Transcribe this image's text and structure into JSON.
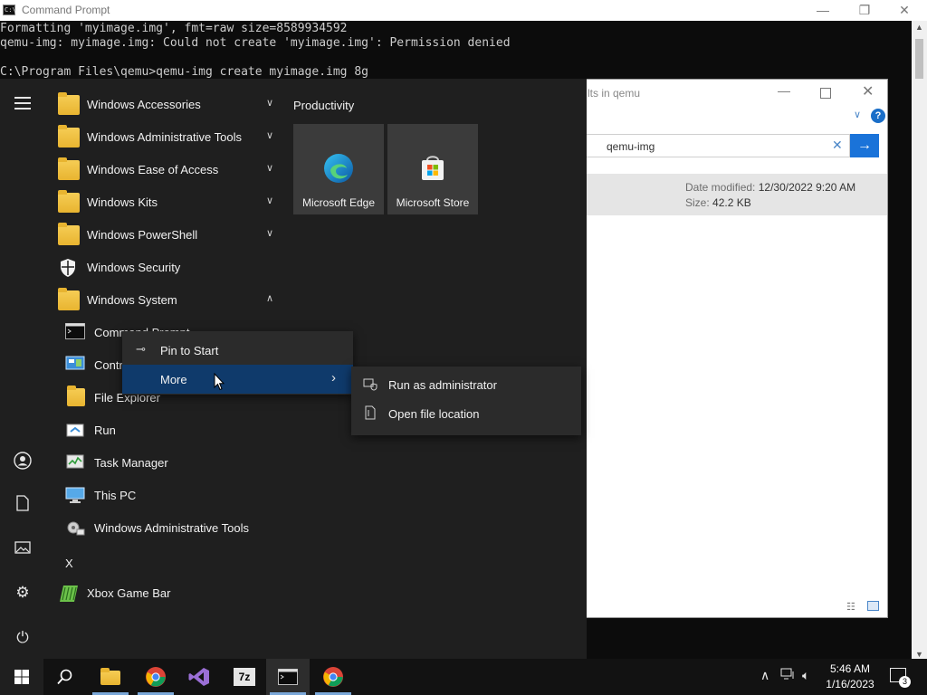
{
  "cmd": {
    "title": "Command Prompt",
    "icon_text": "C:\\",
    "lines": [
      "Formatting 'myimage.img', fmt=raw size=8589934592",
      "qemu-img: myimage.img: Could not create 'myimage.img': Permission denied",
      "",
      "C:\\Program Files\\qemu>qemu-img create myimage.img 8g"
    ],
    "minimize": "—",
    "maximize": "❐",
    "close": "✕"
  },
  "explorer": {
    "title_fragment": "lts in qemu",
    "search_value": "qemu-img",
    "result": {
      "date_label": "Date modified:",
      "date_value": "12/30/2022 9:20 AM",
      "size_label": "Size:",
      "size_value": "42.2 KB"
    }
  },
  "start_menu": {
    "rail": {
      "items": [
        "user-icon",
        "documents-icon",
        "pictures-icon",
        "settings-icon",
        "power-icon"
      ]
    },
    "apps": [
      {
        "label": "Windows Accessories",
        "type": "folder",
        "expanded": false
      },
      {
        "label": "Windows Administrative Tools",
        "type": "folder",
        "expanded": false
      },
      {
        "label": "Windows Ease of Access",
        "type": "folder",
        "expanded": false
      },
      {
        "label": "Windows Kits",
        "type": "folder",
        "expanded": false
      },
      {
        "label": "Windows PowerShell",
        "type": "folder",
        "expanded": false
      },
      {
        "label": "Windows Security",
        "type": "app"
      },
      {
        "label": "Windows System",
        "type": "folder",
        "expanded": true
      }
    ],
    "system_items": [
      {
        "label": "Command Prompt"
      },
      {
        "label": "Control Panel"
      },
      {
        "label": "File Explorer"
      },
      {
        "label": "Run"
      },
      {
        "label": "Task Manager"
      },
      {
        "label": "This PC"
      },
      {
        "label": "Windows Administrative Tools"
      }
    ],
    "letter_header": "X",
    "x_items": [
      {
        "label": "Xbox Game Bar"
      }
    ],
    "tiles_group": "Productivity",
    "tiles": [
      {
        "label": "Microsoft Edge"
      },
      {
        "label": "Microsoft Store"
      }
    ]
  },
  "context_menu": {
    "items": [
      {
        "label": "Pin to Start"
      },
      {
        "label": "More"
      }
    ],
    "submenu": [
      {
        "label": "Run as administrator"
      },
      {
        "label": "Open file location"
      }
    ]
  },
  "taskbar": {
    "time": "5:46 AM",
    "date": "1/16/2023",
    "notification_count": "3",
    "pinned": [
      "file-explorer-icon",
      "chrome-icon",
      "visual-studio-icon",
      "7zip-icon",
      "command-prompt-icon",
      "chrome-icon"
    ]
  },
  "colors": {
    "start_bg": "#1f1f1f",
    "context_highlight": "#0f3a6b",
    "taskbar_bg": "#121212",
    "accent_blue": "#1a73d9"
  }
}
